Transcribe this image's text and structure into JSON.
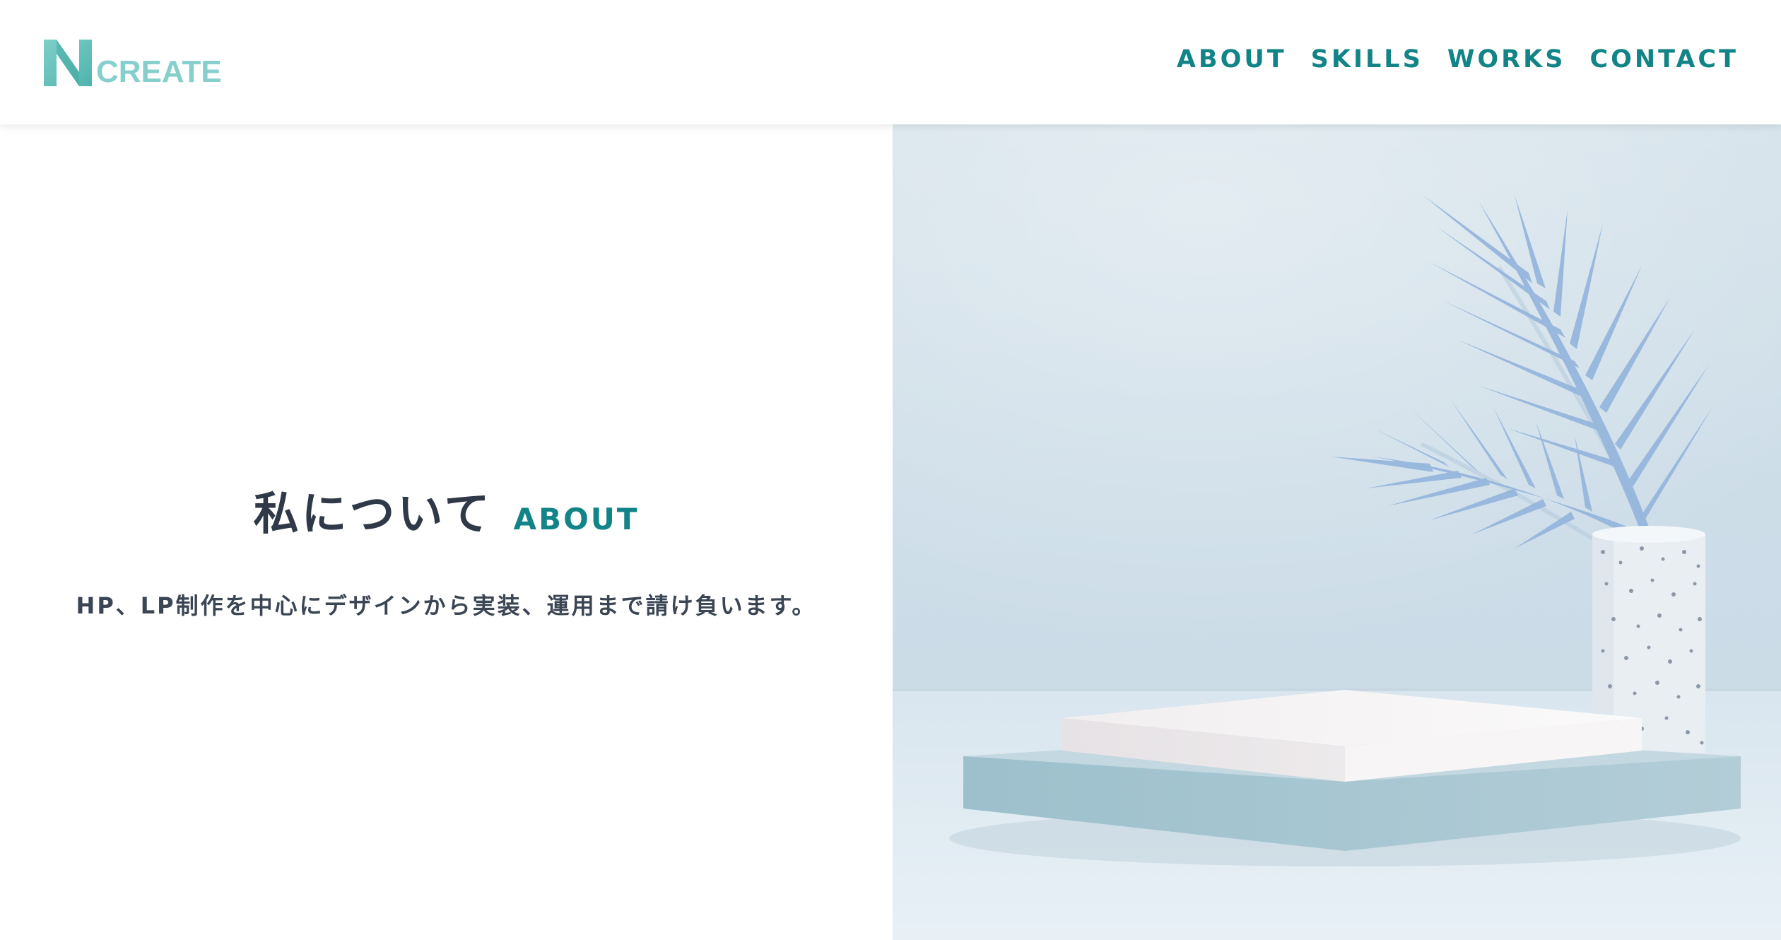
{
  "header": {
    "logo_text": "CREATE",
    "nav": [
      {
        "label": "ABOUT"
      },
      {
        "label": "SKILLS"
      },
      {
        "label": "WORKS"
      },
      {
        "label": "CONTACT"
      }
    ]
  },
  "about": {
    "heading_jp": "私について",
    "heading_en": "ABOUT",
    "description": "HP、LP制作を中心にデザインから実装、運用まで請け負います。"
  },
  "colors": {
    "accent": "#128487",
    "logo": "#86cfcc",
    "text": "#2f3947"
  }
}
